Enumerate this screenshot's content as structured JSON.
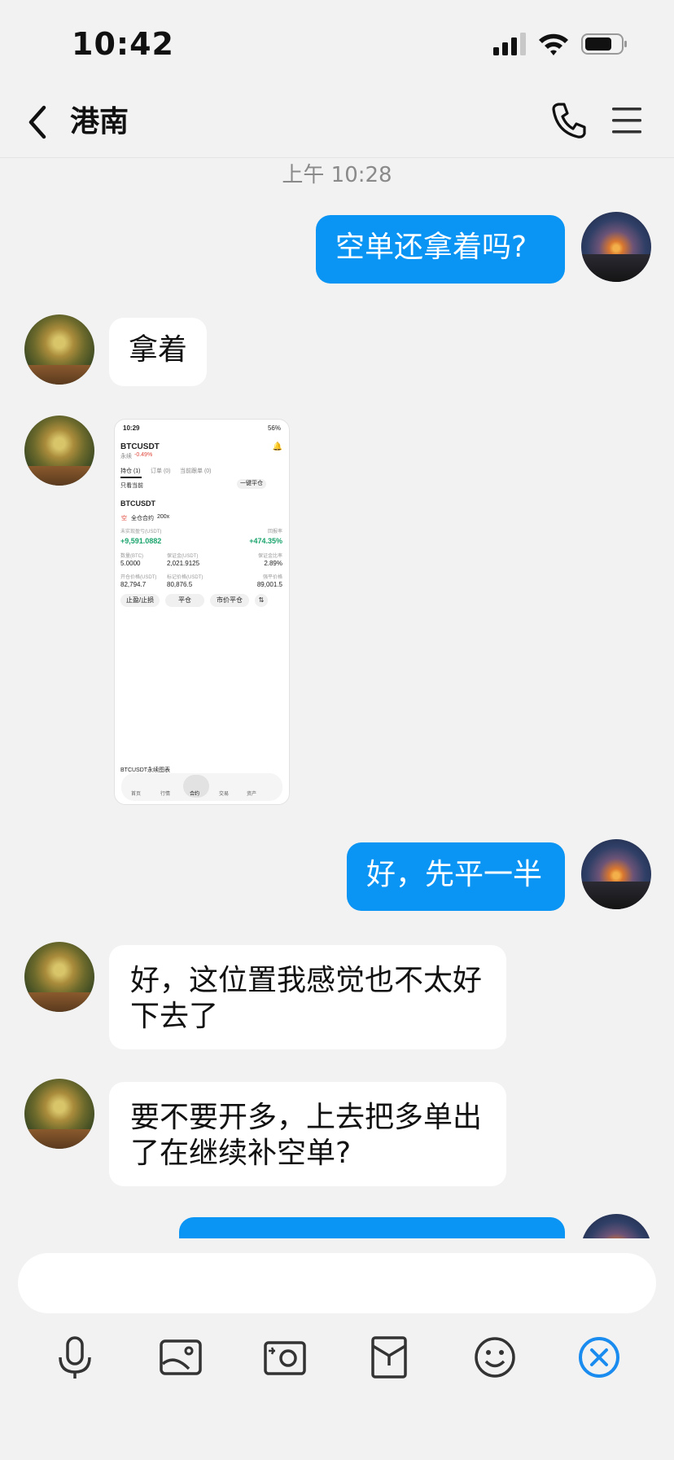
{
  "status_bar": {
    "time": "10:42",
    "battery_icon": "battery-icon",
    "wifi_icon": "wifi-icon",
    "signal_icon": "signal-icon"
  },
  "header": {
    "title": "港南",
    "back_icon": "chevron-left-icon",
    "call_icon": "phone-icon",
    "menu_icon": "menu-icon"
  },
  "chat": {
    "timestamp": "上午 10:28",
    "messages": [
      {
        "side": "out",
        "text": "空单还拿着吗?"
      },
      {
        "side": "in",
        "text": "拿着"
      },
      {
        "side": "in",
        "type": "image"
      },
      {
        "side": "out",
        "text": "好，先平一半"
      },
      {
        "side": "in",
        "text": "好，这位置我感觉也不太好下去了"
      },
      {
        "side": "in",
        "text": "要不要开多，上去把多单出了在继续补空单?"
      },
      {
        "side": "out",
        "text": ""
      }
    ]
  },
  "screenshot": {
    "time": "10:29",
    "battery": "56%",
    "pair": "BTCUSDT",
    "pair_sub": "永续",
    "change": "-0.49%",
    "tabs": [
      "持仓 (1)",
      "订单 (0)",
      "当前跟单 (0)"
    ],
    "hide_other": "只看当前",
    "close_all": "一键平仓",
    "position_symbol": "BTCUSDT",
    "side_badge": "空",
    "margin_mode": "全仓合约",
    "leverage": "200x",
    "pnl_label": "未实现盈亏(USDT)",
    "pnl_value": "+9,591.0882",
    "roe_label": "回报率",
    "roe_value": "+474.35%",
    "row1_labels": [
      "数量(BTC)",
      "保证金(USDT)",
      "保证金比率"
    ],
    "row1_values": [
      "5.0000",
      "2,021.9125",
      "2.89%"
    ],
    "row2_labels": [
      "开仓价格(USDT)",
      "标记价格(USDT)",
      "强平价格"
    ],
    "row2_values": [
      "82,794.7",
      "80,876.5",
      "89,001.5"
    ],
    "buttons": [
      "止盈/止损",
      "平仓",
      "市价平仓"
    ],
    "chart_label": "BTCUSDT永续图表",
    "nav": [
      "首页",
      "行情",
      "合约",
      "交易",
      "资产"
    ]
  },
  "composer": {
    "input_placeholder": "",
    "tools": [
      "microphone-icon",
      "image-icon",
      "camera-icon",
      "red-packet-icon",
      "emoji-icon",
      "close-circle-icon"
    ]
  },
  "colors": {
    "outgoing_bubble": "#0a94f3",
    "incoming_bubble": "#ffffff",
    "background": "#f2f2f2",
    "accent": "#1a8cf0"
  }
}
